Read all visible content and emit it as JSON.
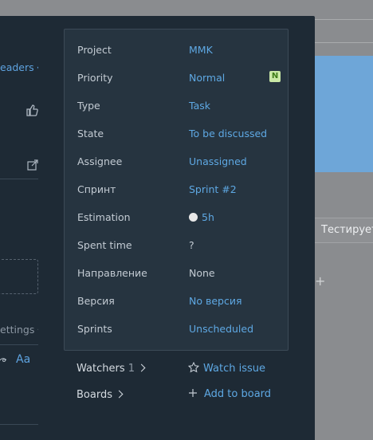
{
  "background": {
    "tab_label": "Тестирует",
    "plus_icon": "+"
  },
  "sidebar": {
    "readers_label": "eaders",
    "settings_label": "ettings",
    "format_label": "Aa"
  },
  "fields": [
    {
      "label": "Project",
      "value": "MMK",
      "link": true
    },
    {
      "label": "Priority",
      "value": "Normal",
      "link": true,
      "badge": "N"
    },
    {
      "label": "Type",
      "value": "Task",
      "link": true
    },
    {
      "label": "State",
      "value": "To be discussed",
      "link": true
    },
    {
      "label": "Assignee",
      "value": "Unassigned",
      "link": true
    },
    {
      "label": "Спринт",
      "value": "Sprint #2",
      "link": true
    },
    {
      "label": "Estimation",
      "value": "5h",
      "link": true,
      "dot": true
    },
    {
      "label": "Spent time",
      "value": "?",
      "link": false
    },
    {
      "label": "Направление",
      "value": "None",
      "link": false
    },
    {
      "label": "Версия",
      "value": "No версия",
      "link": true
    },
    {
      "label": "Sprints",
      "value": "Unscheduled",
      "link": true
    }
  ],
  "footer": {
    "watchers_label": "Watchers",
    "watchers_count": "1",
    "watch_issue_label": "Watch issue",
    "boards_label": "Boards",
    "add_to_board_label": "Add to board"
  },
  "colors": {
    "panel_bg": "#1e2a35",
    "fields_bg": "#263440",
    "link": "#5ea8e3",
    "text": "#c3cbd3",
    "badge_bg": "#c9e8a6"
  }
}
